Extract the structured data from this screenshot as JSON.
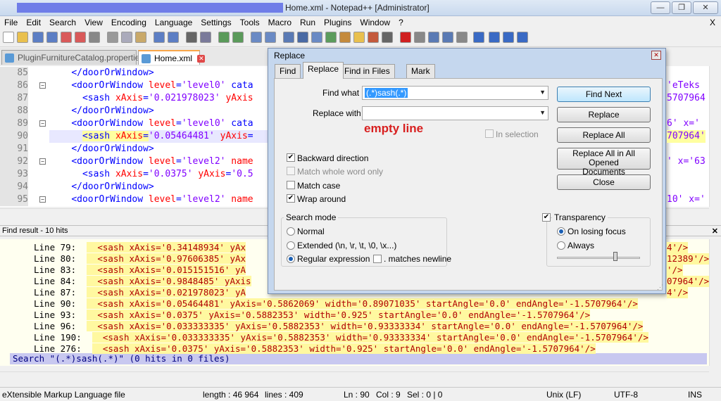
{
  "window": {
    "title": "Home.xml - Notepad++ [Administrator]",
    "minimize": "—",
    "maximize": "❐",
    "close": "✕"
  },
  "menu": [
    "File",
    "Edit",
    "Search",
    "View",
    "Encoding",
    "Language",
    "Settings",
    "Tools",
    "Macro",
    "Run",
    "Plugins",
    "Window",
    "?"
  ],
  "menu_close": "X",
  "tabs": [
    {
      "label": "PluginFurnitureCatalog.properties",
      "close": "✕"
    },
    {
      "label": "Home.xml",
      "close": "✕"
    }
  ],
  "editor": {
    "lines": [
      {
        "num": "85",
        "indent": "    ",
        "parts": [
          [
            "tag",
            "</doorOrWindow>"
          ]
        ]
      },
      {
        "num": "86",
        "indent": "    ",
        "parts": [
          [
            "tag",
            "<doorOrWindow "
          ],
          [
            "attr",
            "level"
          ],
          [
            "tag",
            "="
          ],
          [
            "val",
            "'level0'"
          ],
          [
            "tag",
            " cata"
          ]
        ]
      },
      {
        "num": "87",
        "indent": "      ",
        "parts": [
          [
            "tag",
            "<sash "
          ],
          [
            "attr",
            "xAxis"
          ],
          [
            "tag",
            "="
          ],
          [
            "val",
            "'0.021978023'"
          ],
          [
            "attr",
            " yAxis"
          ]
        ]
      },
      {
        "num": "88",
        "indent": "    ",
        "parts": [
          [
            "tag",
            "</doorOrWindow>"
          ]
        ]
      },
      {
        "num": "89",
        "indent": "    ",
        "parts": [
          [
            "tag",
            "<doorOrWindow "
          ],
          [
            "attr",
            "level"
          ],
          [
            "tag",
            "="
          ],
          [
            "val",
            "'level0'"
          ],
          [
            "tag",
            " cata"
          ]
        ]
      },
      {
        "num": "90",
        "indent": "      ",
        "parts": [
          [
            "tag",
            "<sash "
          ],
          [
            "attr",
            "xAxis"
          ],
          [
            "tag",
            "="
          ],
          [
            "val",
            "'0.05464481'"
          ],
          [
            "attr",
            " yAxis"
          ],
          [
            "tag",
            "="
          ]
        ]
      },
      {
        "num": "91",
        "indent": "    ",
        "parts": [
          [
            "tag",
            "</doorOrWindow>"
          ]
        ]
      },
      {
        "num": "92",
        "indent": "    ",
        "parts": [
          [
            "tag",
            "<doorOrWindow "
          ],
          [
            "attr",
            "level"
          ],
          [
            "tag",
            "="
          ],
          [
            "val",
            "'level2'"
          ],
          [
            "attr",
            " name"
          ]
        ]
      },
      {
        "num": "93",
        "indent": "      ",
        "parts": [
          [
            "tag",
            "<sash "
          ],
          [
            "attr",
            "xAxis"
          ],
          [
            "tag",
            "="
          ],
          [
            "val",
            "'0.0375'"
          ],
          [
            "attr",
            " yAxis"
          ],
          [
            "tag",
            "="
          ],
          [
            "val",
            "'0.5"
          ]
        ]
      },
      {
        "num": "94",
        "indent": "    ",
        "parts": [
          [
            "tag",
            "</doorOrWindow>"
          ]
        ]
      },
      {
        "num": "95",
        "indent": "    ",
        "parts": [
          [
            "tag",
            "<doorOrWindow "
          ],
          [
            "attr",
            "level"
          ],
          [
            "tag",
            "="
          ],
          [
            "val",
            "'level2'"
          ],
          [
            "attr",
            " name"
          ]
        ]
      }
    ],
    "right_snips": [
      "",
      "'eTeks",
      "5707964",
      "",
      "6' x='",
      "707964'",
      "",
      "' x='63",
      "",
      "",
      "10' x='"
    ]
  },
  "find_result": {
    "header": "Find result - 10 hits",
    "rows": [
      {
        "line": "Line 79:  ",
        "text": "  <sash xAxis='0.34148934' yAx",
        "tail": "4'/>"
      },
      {
        "line": "Line 80:  ",
        "text": "  <sash xAxis='0.97606385' yAx",
        "tail": "12389'/>"
      },
      {
        "line": "Line 83:  ",
        "text": "  <sash xAxis='0.015151516' yA",
        "tail": "'/>"
      },
      {
        "line": "Line 84:  ",
        "text": "  <sash xAxis='0.9848485' yAxis",
        "tail": "07964'/>"
      },
      {
        "line": "Line 87:  ",
        "text": "  <sash xAxis='0.021978023' yA",
        "tail": "4'/>"
      },
      {
        "line": "Line 90:  ",
        "text": "  <sash xAxis='0.05464481' yAxis='0.5862069' width='0.89071035' startAngle='0.0' endAngle='-1.5707964'/>",
        "tail": ""
      },
      {
        "line": "Line 93:  ",
        "text": "  <sash xAxis='0.0375' yAxis='0.5882353' width='0.925' startAngle='0.0' endAngle='-1.5707964'/>",
        "tail": ""
      },
      {
        "line": "Line 96:  ",
        "text": "  <sash xAxis='0.033333335' yAxis='0.5882353' width='0.93333334' startAngle='0.0' endAngle='-1.5707964'/>",
        "tail": ""
      },
      {
        "line": "Line 190:  ",
        "text": "  <sash xAxis='0.033333335' yAxis='0.5882353' width='0.93333334' startAngle='0.0' endAngle='-1.5707964'/>",
        "tail": ""
      },
      {
        "line": "Line 276:  ",
        "text": "  <sash xAxis='0.0375' yAxis='0.5882353' width='0.925' startAngle='0.0' endAngle='-1.5707964'/>",
        "tail": ""
      }
    ],
    "search_line": "Search \"(.*)sash(.*)\" (0 hits in 0 files)"
  },
  "dialog": {
    "title": "Replace",
    "tabs": [
      "Find",
      "Replace",
      "Find in Files",
      "Mark"
    ],
    "find_what_label": "Find what :",
    "find_what_value": "(.*)sash(.*)",
    "replace_with_label": "Replace with :",
    "replace_with_value": "",
    "annotation": "empty line",
    "in_selection": "In selection",
    "backward": "Backward direction",
    "whole_word": "Match whole word only",
    "match_case": "Match case",
    "wrap_around": "Wrap around",
    "search_mode_title": "Search mode",
    "mode_normal": "Normal",
    "mode_extended": "Extended (\\n, \\r, \\t, \\0, \\x...)",
    "mode_regex": "Regular expression",
    "matches_newline": ". matches newline",
    "transparency": "Transparency",
    "on_losing_focus": "On losing focus",
    "always": "Always",
    "buttons": {
      "find_next": "Find Next",
      "replace": "Replace",
      "replace_all": "Replace All",
      "replace_all_opened_1": "Replace All in All Opened",
      "replace_all_opened_2": "Documents",
      "close": "Close"
    },
    "transparency_level": 0.7
  },
  "status": {
    "filetype": "eXtensible Markup Language file",
    "length": "length : 46 964",
    "lines": "lines : 409",
    "ln": "Ln : 90",
    "col": "Col : 9",
    "sel": "Sel : 0 | 0",
    "eol": "Unix (LF)",
    "enc": "UTF-8",
    "ins": "INS"
  }
}
